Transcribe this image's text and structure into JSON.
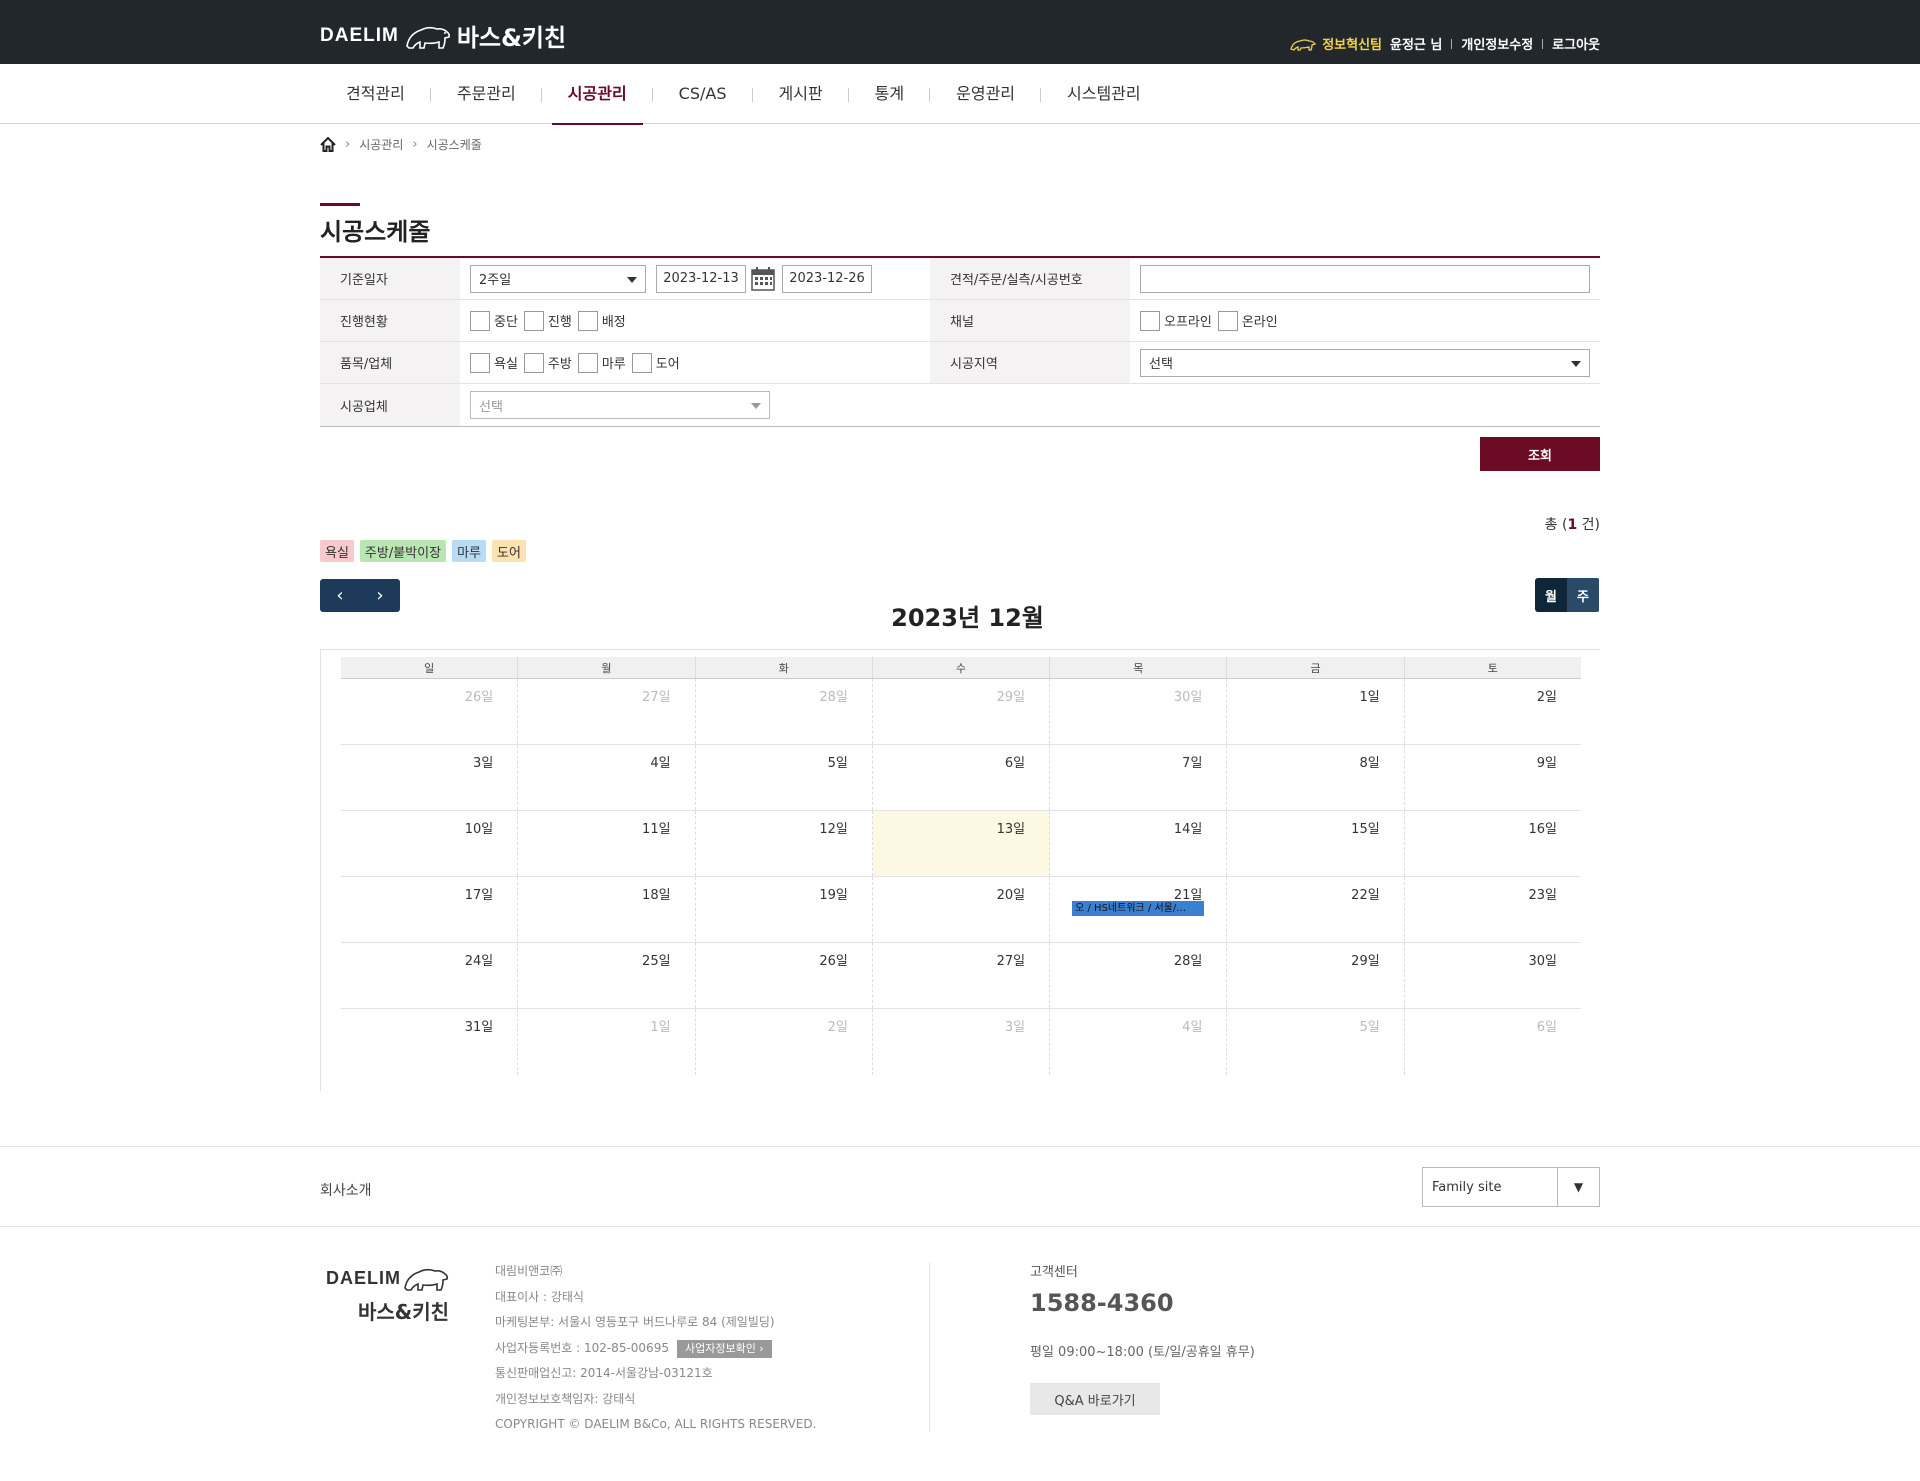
{
  "header": {
    "logo_en": "DAELIM",
    "logo_kr": "바스&키친",
    "team": "정보혁신팀",
    "user": "윤정근 님",
    "privacy_edit": "개인정보수정",
    "logout": "로그아웃"
  },
  "nav": {
    "items": [
      "견적관리",
      "주문관리",
      "시공관리",
      "CS/AS",
      "게시판",
      "통계",
      "운영관리",
      "시스템관리"
    ],
    "active_index": 2
  },
  "breadcrumb": [
    "시공관리",
    "시공스케줄"
  ],
  "page_title": "시공스케줄",
  "search": {
    "date_label": "기준일자",
    "period_value": "2주일",
    "date_from": "2023-12-13",
    "date_to": "2023-12-26",
    "number_label": "견적/주문/실측/시공번호",
    "number_value": "",
    "status_label": "진행현황",
    "status_options": [
      "중단",
      "진행",
      "배정"
    ],
    "channel_label": "채널",
    "channel_options": [
      "오프라인",
      "온라인"
    ],
    "item_label": "품목/업체",
    "item_options": [
      "욕실",
      "주방",
      "마루",
      "도어"
    ],
    "region_label": "시공지역",
    "region_value": "선택",
    "vendor_label": "시공업체",
    "vendor_placeholder": "선택",
    "submit_label": "조회"
  },
  "total": {
    "prefix": "총 (",
    "count": "1",
    "suffix": " 건)"
  },
  "legend": [
    {
      "label": "욕실",
      "color": "#f6c9cc"
    },
    {
      "label": "주방/붙박이장",
      "color": "#b8e6b0"
    },
    {
      "label": "마루",
      "color": "#b9dcf6"
    },
    {
      "label": "도어",
      "color": "#fbe2b0"
    }
  ],
  "calendar": {
    "title": "2023년 12월",
    "prev": "‹",
    "next": "›",
    "view_month": "월",
    "view_week": "주",
    "weekdays": [
      "일",
      "월",
      "화",
      "수",
      "목",
      "금",
      "토"
    ],
    "weeks": [
      [
        "26일",
        "27일",
        "28일",
        "29일",
        "30일",
        "1일",
        "2일"
      ],
      [
        "3일",
        "4일",
        "5일",
        "6일",
        "7일",
        "8일",
        "9일"
      ],
      [
        "10일",
        "11일",
        "12일",
        "13일",
        "14일",
        "15일",
        "16일"
      ],
      [
        "17일",
        "18일",
        "19일",
        "20일",
        "21일",
        "22일",
        "23일"
      ],
      [
        "24일",
        "25일",
        "26일",
        "27일",
        "28일",
        "29일",
        "30일"
      ],
      [
        "31일",
        "1일",
        "2일",
        "3일",
        "4일",
        "5일",
        "6일"
      ]
    ],
    "event": {
      "label": "오 / HS네트워크 / 서울/…",
      "color": "#3a7fd0"
    },
    "today_color": "#fdf8e2"
  },
  "footer": {
    "company_link": "회사소개",
    "family_site": "Family site",
    "family_arrow": "▼",
    "logo_en": "DAELIM",
    "logo_kr": "바스&키친",
    "info": [
      "대림비앤코㈜",
      "대표이사 : 강태식",
      "마케팅본부: 서울시 영등포구 버드나루로 84 (제일빌딩)",
      "사업자등록번호 : 102-85-00695",
      "통신판매업신고: 2014-서울강남-03121호",
      "개인정보보호책임자: 강태식",
      "COPYRIGHT © DAELIM B&Co, ALL RIGHTS RESERVED."
    ],
    "biz_check": "사업자정보확인 ›",
    "cs_label": "고객센터",
    "cs_phone": "1588-4360",
    "cs_hours": "평일 09:00~18:00 (토/일/공휴일 휴무)",
    "qa_button": "Q&A 바로가기"
  },
  "colors": {
    "brand": "#6b0a23",
    "topbar": "#22272c",
    "nav_dark": "#1e3a5a"
  }
}
